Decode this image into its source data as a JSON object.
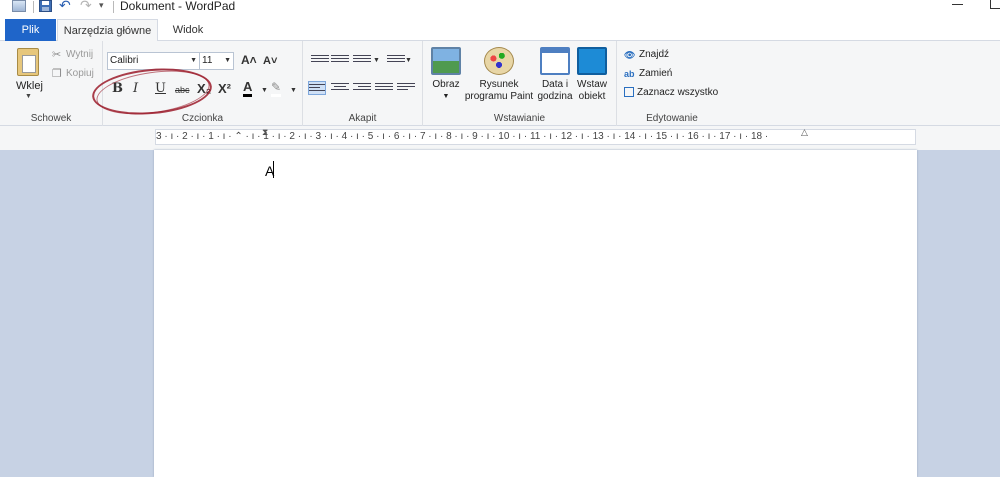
{
  "window": {
    "title": "Dokument - WordPad",
    "qat_more": "▾"
  },
  "tabs": {
    "file": "Plik",
    "home": "Narzędzia główne",
    "view": "Widok"
  },
  "clipboard": {
    "paste": "Wklej",
    "cut": "Wytnij",
    "copy": "Kopiuj",
    "group": "Schowek"
  },
  "font": {
    "name": "Calibri",
    "size": "11",
    "group": "Czcionka",
    "bold": "B",
    "italic": "I",
    "underline": "U",
    "strike": "abc",
    "subscript": "X₂",
    "superscript": "X²",
    "color": "A",
    "grow": "A˄",
    "shrink": "A˅"
  },
  "paragraph": {
    "group": "Akapit"
  },
  "insert": {
    "picture": "Obraz",
    "paint_line1": "Rysunek",
    "paint_line2": "programu Paint",
    "date_line1": "Data i",
    "date_line2": "godzina",
    "object_line1": "Wstaw",
    "object_line2": "obiekt",
    "group": "Wstawianie"
  },
  "editing": {
    "find": "Znajdź",
    "replace": "Zamień",
    "select_all": "Zaznacz wszystko",
    "group": "Edytowanie"
  },
  "ruler": {
    "text": "3 · ı · 2 · ı · 1 · ı · ⌃ · ı · 1 · ı · 2 · ı · 3 · ı · 4 · ı · 5 · ı · 6 · ı · 7 · ı · 8 · ı · 9 · ı · 10 · ı · 11 · ı · 12 · ı · 13 · ı · 14 · ı · 15 · ı · 16 · ı · 17 · ı · 18 ·"
  },
  "document": {
    "text": "A"
  },
  "colors": {
    "accent": "#1f65c9",
    "annotation": "#9b1b2a",
    "workspace": "#c7d2e4"
  }
}
